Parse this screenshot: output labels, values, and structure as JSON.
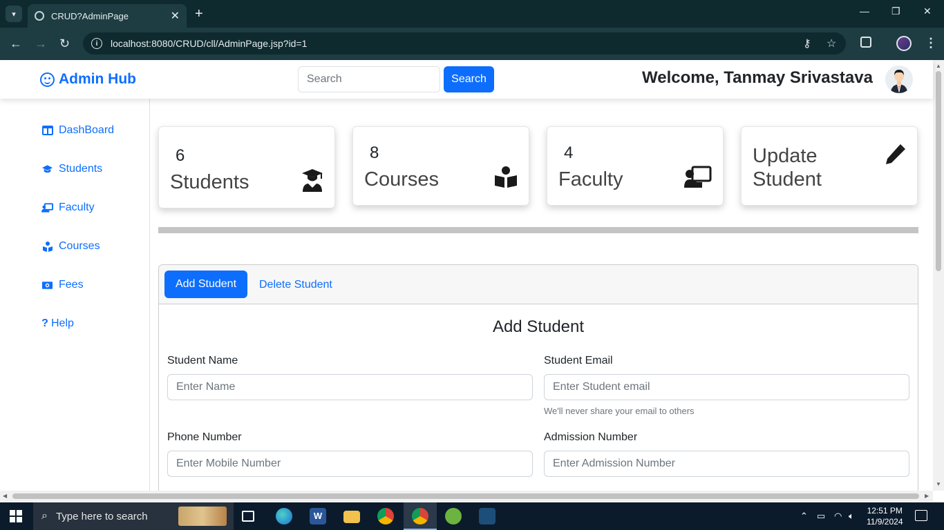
{
  "browser": {
    "tab_title": "CRUD?AdminPage",
    "url": "localhost:8080/CRUD/cll/AdminPage.jsp?id=1",
    "new_tab": "+",
    "minimize": "—",
    "restore": "❐",
    "close": "✕"
  },
  "header": {
    "brand": "Admin Hub",
    "search_placeholder": "Search",
    "search_button": "Search",
    "welcome": "Welcome, Tanmay Srivastava"
  },
  "sidebar": {
    "items": [
      {
        "label": "DashBoard",
        "icon": "columns-icon"
      },
      {
        "label": "Students",
        "icon": "graduation-cap-icon"
      },
      {
        "label": "Faculty",
        "icon": "teacher-icon"
      },
      {
        "label": "Courses",
        "icon": "book-reader-icon"
      },
      {
        "label": "Fees",
        "icon": "money-icon"
      },
      {
        "label": "Help",
        "icon": "question-icon"
      }
    ]
  },
  "cards": [
    {
      "count": "6",
      "label": "Students",
      "icon": "user-graduate-icon"
    },
    {
      "count": "8",
      "label": "Courses",
      "icon": "book-reader-icon"
    },
    {
      "count": "4",
      "label": "Faculty",
      "icon": "chalkboard-teacher-icon"
    },
    {
      "label_line1": "Update",
      "label_line2": "Student",
      "icon": "pencil-icon"
    }
  ],
  "panel": {
    "tabs": [
      "Add Student",
      "Delete Student"
    ],
    "title": "Add Student",
    "fields": {
      "name": {
        "label": "Student Name",
        "placeholder": "Enter Name"
      },
      "email": {
        "label": "Student Email",
        "placeholder": "Enter Student email",
        "help": "We'll never share your email to others"
      },
      "phone": {
        "label": "Phone Number",
        "placeholder": "Enter Mobile Number"
      },
      "admission": {
        "label": "Admission Number",
        "placeholder": "Enter Admission Number"
      }
    }
  },
  "taskbar": {
    "search_placeholder": "Type here to search",
    "time": "12:51 PM",
    "date": "11/9/2024"
  },
  "colors": {
    "primary": "#0d6efd",
    "chrome_dark": "#0f2a2f",
    "chrome_mid": "#1e3d43"
  }
}
